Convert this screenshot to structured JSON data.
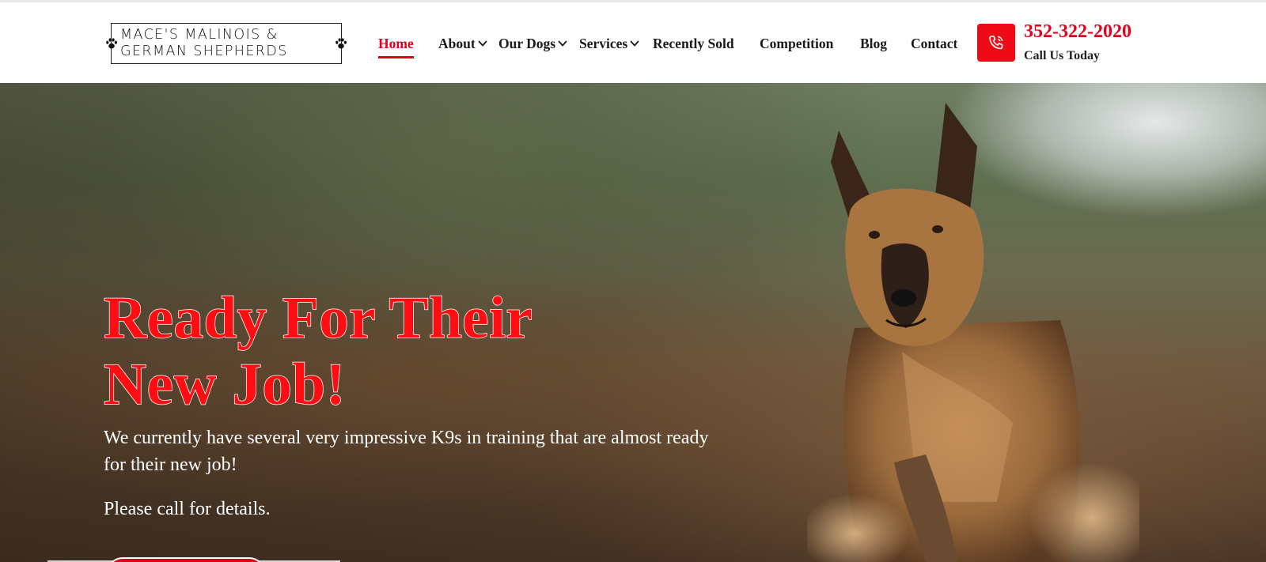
{
  "logo": {
    "line1": "Mace's Malinois &",
    "line2": "German Shepherds"
  },
  "nav": {
    "items": [
      {
        "label": "Home",
        "active": true,
        "has_dropdown": false
      },
      {
        "label": "About",
        "active": false,
        "has_dropdown": true
      },
      {
        "label": "Our Dogs",
        "active": false,
        "has_dropdown": true
      },
      {
        "label": "Services",
        "active": false,
        "has_dropdown": true
      },
      {
        "label": "Recently Sold",
        "active": false,
        "has_dropdown": false
      },
      {
        "label": "Competition",
        "active": false,
        "has_dropdown": false
      },
      {
        "label": "Blog",
        "active": false,
        "has_dropdown": false
      },
      {
        "label": "Contact",
        "active": false,
        "has_dropdown": false
      }
    ]
  },
  "contact": {
    "phone_icon": "phone-icon",
    "phone": "352-322-2020",
    "sub": "Call Us Today"
  },
  "hero": {
    "title_line1": "Ready For Their",
    "title_line2": "New Job!",
    "text": "We currently have several very impressive K9s in training that are almost ready for their new job!",
    "text2": "Please call for details."
  },
  "colors": {
    "accent": "#e3001b",
    "phone_button": "#ef0a16"
  }
}
